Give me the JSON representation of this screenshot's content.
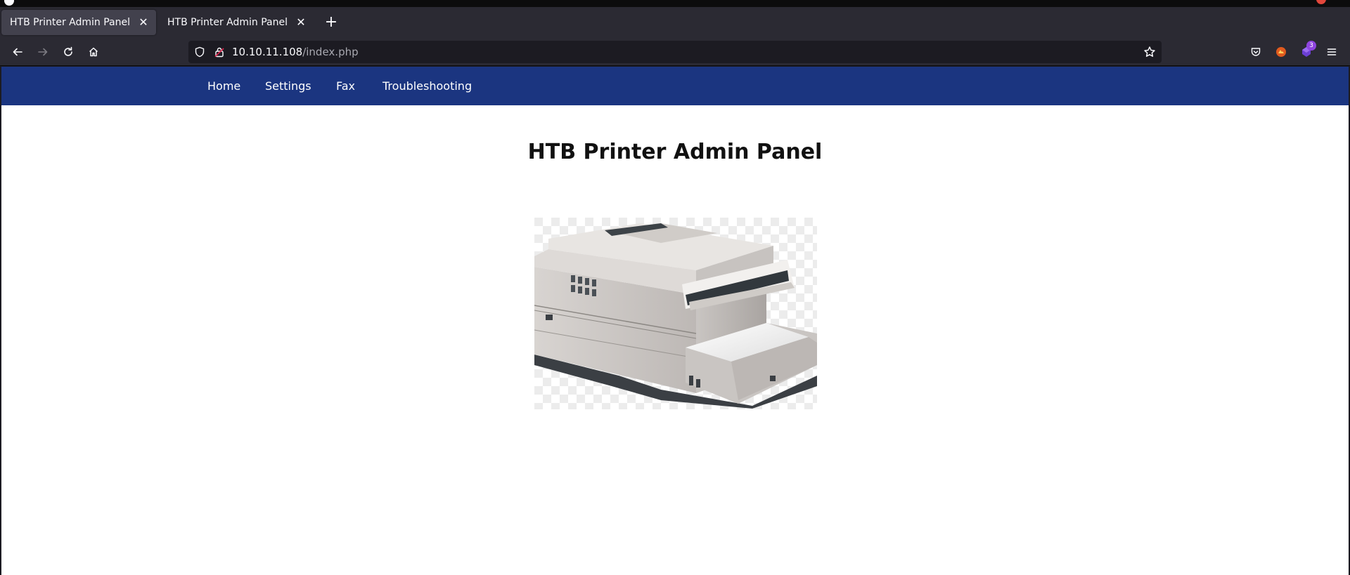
{
  "browser": {
    "tabs": [
      {
        "label": "HTB Printer Admin Panel",
        "active": true
      },
      {
        "label": "HTB Printer Admin Panel",
        "active": false
      }
    ],
    "new_tab_symbol": "+",
    "close_symbol": "✕",
    "url": {
      "host": "10.10.11.108",
      "path": "/index.php"
    },
    "extension_badge": "3",
    "icons": [
      "back-icon",
      "forward-icon",
      "reload-icon",
      "home-icon",
      "shield-icon",
      "lock-icon",
      "star-icon",
      "pocket-icon",
      "extension-icon",
      "extension-icon",
      "menu-icon"
    ]
  },
  "site": {
    "nav": [
      {
        "label": "Home"
      },
      {
        "label": "Settings"
      },
      {
        "label": "Fax"
      },
      {
        "label": "Troubleshooting"
      }
    ],
    "title": "HTB Printer Admin Panel",
    "colors": {
      "nav_bg": "#1b3580",
      "nav_text": "#ffffff"
    }
  }
}
